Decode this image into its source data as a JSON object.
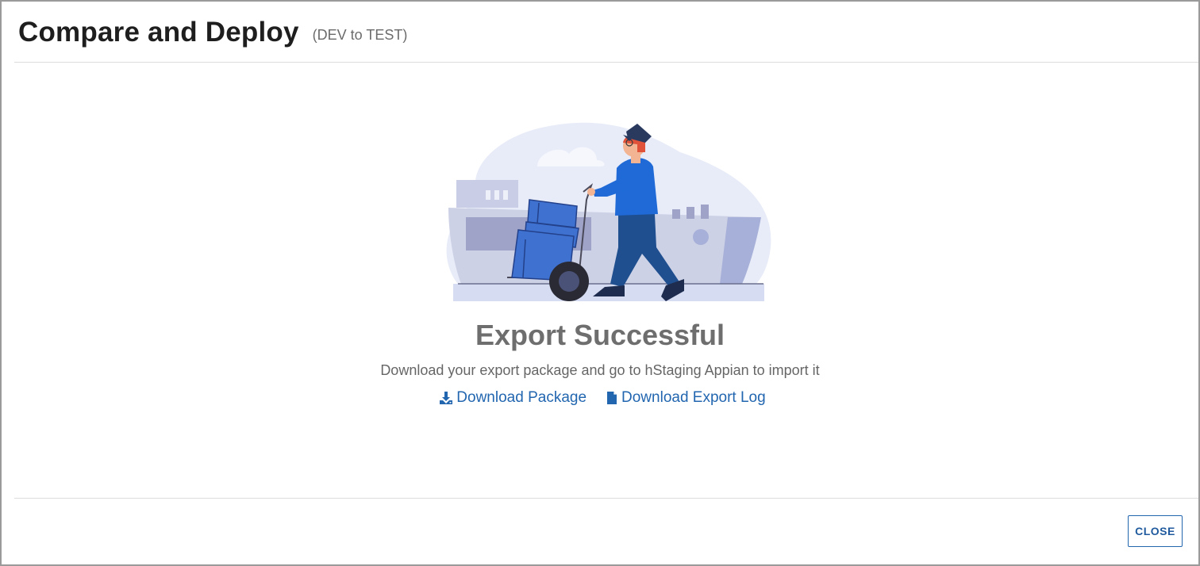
{
  "header": {
    "title": "Compare and Deploy",
    "subtitle": "(DEV to TEST)"
  },
  "illustration": {
    "icon": "delivery-person-hand-truck-illustration"
  },
  "result": {
    "heading": "Export Successful",
    "description": "Download your export package and go to hStaging Appian to import it"
  },
  "links": {
    "download_package": {
      "label": "Download Package",
      "icon": "download-icon"
    },
    "download_log": {
      "label": "Download Export Log",
      "icon": "file-icon"
    }
  },
  "footer": {
    "close_label": "CLOSE"
  },
  "colors": {
    "link": "#2266b0",
    "heading": "#6e6e6e",
    "box_blue": "#3f72d0",
    "coat_blue": "#1f6ad6"
  }
}
